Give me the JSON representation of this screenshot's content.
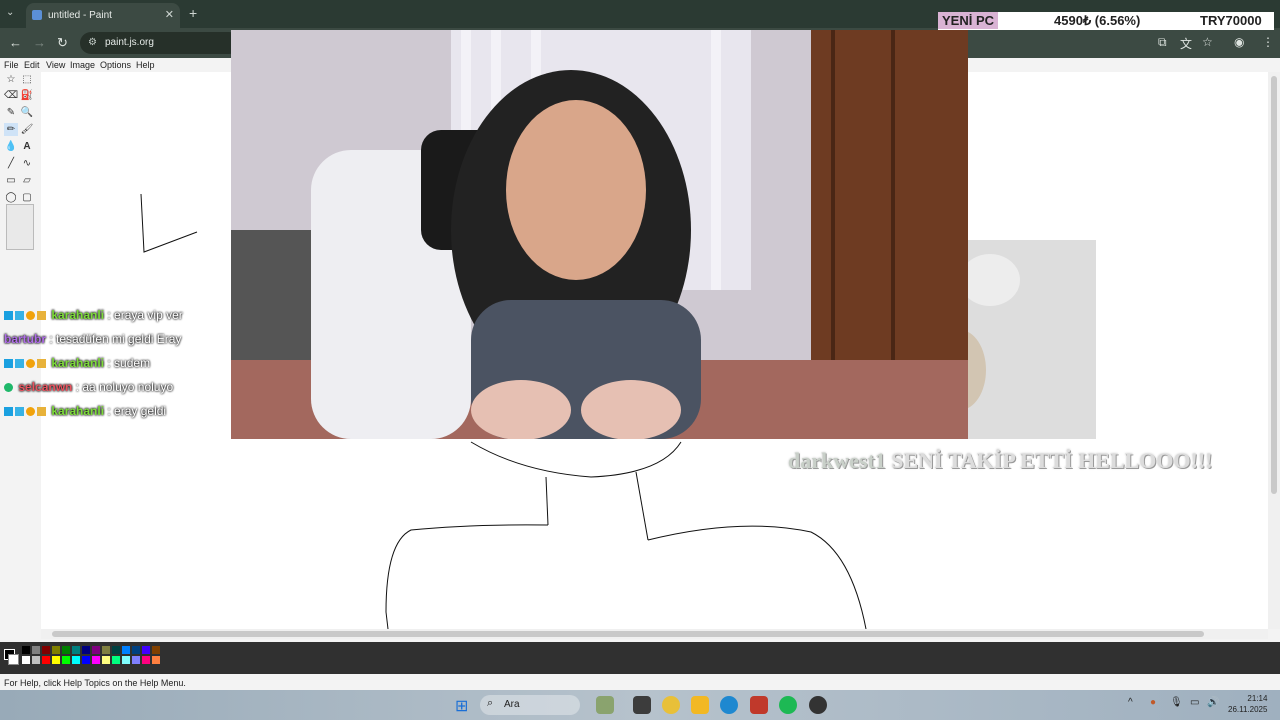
{
  "browser": {
    "tab_title": "untitled - Paint",
    "tab_close": "✕",
    "new_tab": "+",
    "url": "paint.js.org",
    "tabs_menu": "⌄"
  },
  "overlay_ticker": {
    "label": "YENİ PC",
    "progress": "4590₺ (6.56%)",
    "goal": "TRY70000"
  },
  "paint": {
    "menu": [
      "File",
      "Edit",
      "View",
      "Image",
      "Options",
      "Help"
    ],
    "status": "For Help, click Help Topics on the Help Menu.",
    "tools": [
      "☆",
      "⬚",
      "⌫",
      "⛽",
      "✎",
      "🔍",
      "✏",
      "🖌",
      "💧",
      "A",
      "╱",
      "∿",
      "▭",
      "▱",
      "◯",
      "▢"
    ],
    "palette": [
      "#000000",
      "#808080",
      "#800000",
      "#808000",
      "#008000",
      "#008080",
      "#000080",
      "#800080",
      "#808040",
      "#004040",
      "#0080ff",
      "#004080",
      "#4000ff",
      "#804000",
      "#ffffff",
      "#c0c0c0",
      "#ff0000",
      "#ffff00",
      "#00ff00",
      "#00ffff",
      "#0000ff",
      "#ff00ff",
      "#ffff80",
      "#00ff80",
      "#80ffff",
      "#8080ff",
      "#ff0080",
      "#ff8040"
    ]
  },
  "chat": [
    {
      "user": "karahanli",
      "message": ": eraya vip ver",
      "color": "#7ddc3a",
      "badges": true
    },
    {
      "user": "bartubr",
      "message": ": tesadüfen mi geldi Eray",
      "color": "#b06ee8",
      "badges": false
    },
    {
      "user": "karahanli",
      "message": ": sudem",
      "color": "#7ddc3a",
      "badges": true
    },
    {
      "user": "selcanwn",
      "message": ": aa noluyo noluyo",
      "color": "#e8535f",
      "badges": "check"
    },
    {
      "user": "karahanli",
      "message": ": eray geldi",
      "color": "#7ddc3a",
      "badges": true
    }
  ],
  "follow_alert": {
    "user": "darkwest1",
    "text": "SENİ TAKİP ETTİ HELLOOO!!!"
  },
  "taskbar": {
    "search": "Ara",
    "time": "21:14",
    "date": "26.11.2025"
  }
}
